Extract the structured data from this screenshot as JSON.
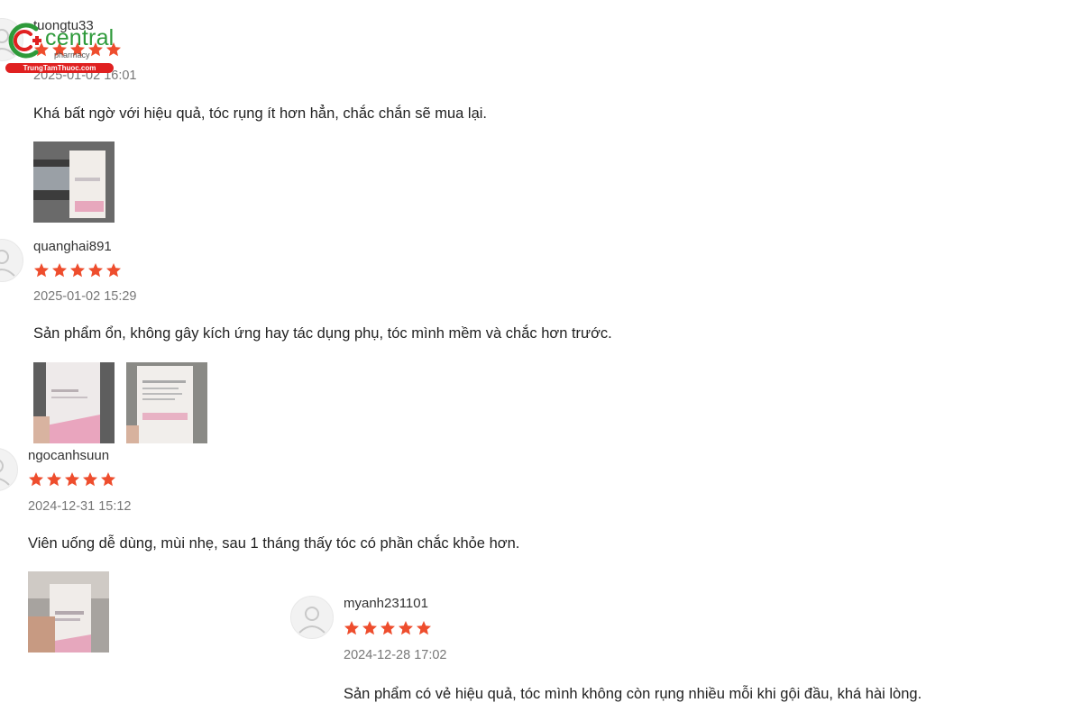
{
  "brand": {
    "name": "central",
    "tagline": "pharmacy",
    "domain": "TrungTamThuoc.com",
    "accent": "#e02020",
    "brand_green": "#2e9a3a"
  },
  "star_color": "#ee4d2d",
  "reviews": [
    {
      "username": "tuongtu33",
      "rating": 5,
      "date": "2025-01-02 16:01",
      "comment": "Khá bất ngờ với hiệu quả, tóc rụng ít hơn hẳn, chắc chắn sẽ mua lại.",
      "photos": 1
    },
    {
      "username": "quanghai891",
      "rating": 5,
      "date": "2025-01-02 15:29",
      "comment": "Sản phẩm ổn, không gây kích ứng hay tác dụng phụ, tóc mình mềm và chắc hơn trước.",
      "photos": 2
    },
    {
      "username": "ngocanhsuun",
      "rating": 5,
      "date": "2024-12-31 15:12",
      "comment": "Viên uống dễ dùng, mùi nhẹ, sau 1 tháng thấy tóc có phần chắc khỏe hơn.",
      "photos": 1
    },
    {
      "username": "myanh231101",
      "rating": 5,
      "date": "2024-12-28 17:02",
      "comment": "Sản phẩm có vẻ hiệu quả, tóc mình không còn rụng nhiều mỗi khi gội đầu, khá hài lòng.",
      "photos": 0
    }
  ]
}
